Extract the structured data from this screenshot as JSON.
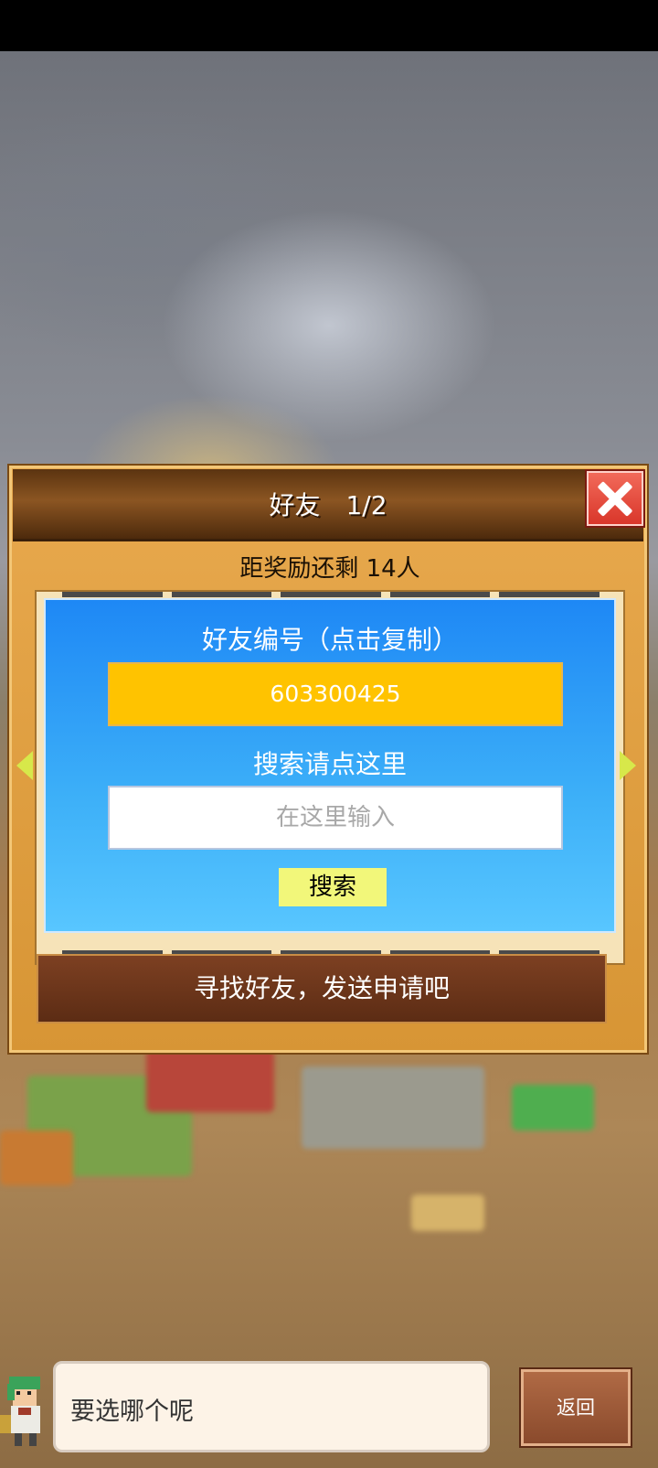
{
  "dialog": {
    "title": "好友　1/2",
    "reward_text": "距奖励还剩 14人",
    "panel": {
      "id_label": "好友编号（点击复制）",
      "friend_id": "603300425",
      "search_label": "搜索请点这里",
      "search_placeholder": "在这里输入",
      "search_button": "搜索"
    },
    "find_button": "寻找好友，发送申请吧"
  },
  "bottom": {
    "speech": "要选哪个呢",
    "back_button": "返回"
  },
  "colors": {
    "title_bar": "#7a4a1e",
    "panel_blue": "#2e9cf6",
    "id_box": "#ffc300",
    "search_button": "#f2f77a",
    "find_button": "#6e3a1e",
    "close_button": "#e04a3c"
  },
  "icons": {
    "close": "close-icon",
    "prev": "arrow-left-icon",
    "next": "arrow-right-icon"
  }
}
